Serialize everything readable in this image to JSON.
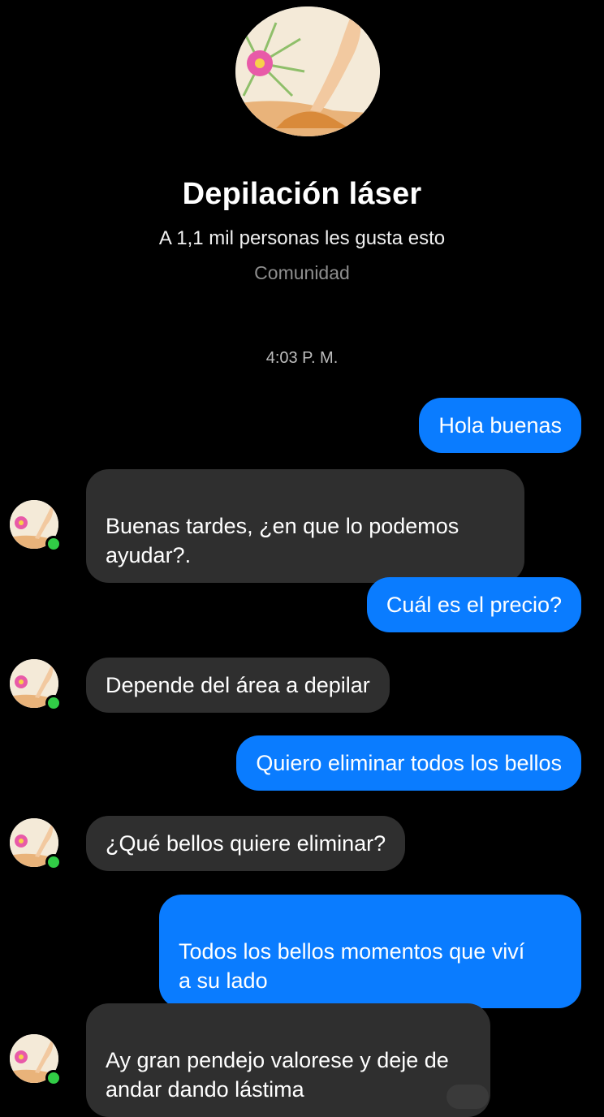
{
  "header": {
    "title": "Depilación láser",
    "likes": "A 1,1 mil personas les gusta esto",
    "category": "Comunidad",
    "avatar_icon": "page-profile-photo"
  },
  "conversation": {
    "timestamp": "4:03 P. M.",
    "messages": [
      {
        "direction": "out",
        "text": "Hola buenas"
      },
      {
        "direction": "in",
        "text": "Buenas tardes, ¿en que lo podemos\nayudar?."
      },
      {
        "direction": "out",
        "text": "Cuál es el precio?"
      },
      {
        "direction": "in",
        "text": "Depende del área a depilar"
      },
      {
        "direction": "out",
        "text": "Quiero eliminar todos los bellos"
      },
      {
        "direction": "in",
        "text": "¿Qué bellos quiere eliminar?"
      },
      {
        "direction": "out",
        "text": "Todos los bellos momentos que viví\na su lado"
      },
      {
        "direction": "in",
        "text": "Ay gran pendejo valorese y deje de\nandar dando lástima"
      }
    ]
  },
  "colors": {
    "background": "#000000",
    "outgoing_bubble": "#0a7cff",
    "incoming_bubble": "#2f2f2f",
    "online": "#31cc46"
  }
}
